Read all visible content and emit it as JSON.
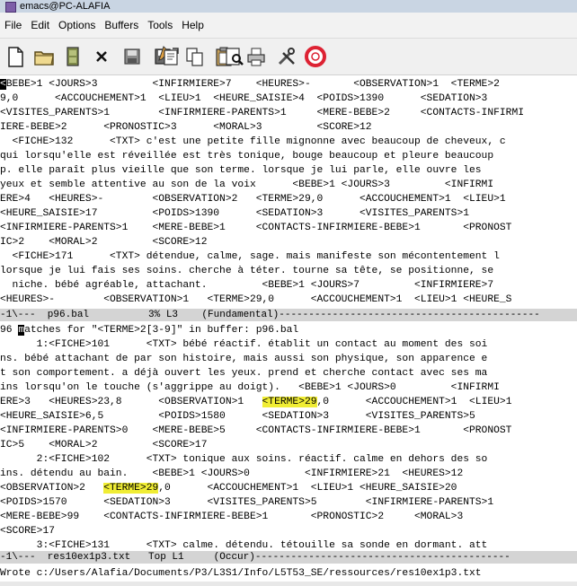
{
  "window": {
    "title": "emacs@PC-ALAFIA"
  },
  "menu": [
    "File",
    "Edit",
    "Options",
    "Buffers",
    "Tools",
    "Help"
  ],
  "toolbar": [
    {
      "name": "new-file-icon",
      "glyph": "new"
    },
    {
      "name": "open-folder-icon",
      "glyph": "folder"
    },
    {
      "name": "save-disk-icon",
      "glyph": "cabinet"
    },
    {
      "name": "close-buffer-icon",
      "glyph": "x"
    },
    {
      "name": "save-icon",
      "glyph": "disk"
    },
    {
      "name": "save-as-icon",
      "glyph": "disk2"
    },
    {
      "name": "undo-icon",
      "glyph": "undo"
    },
    {
      "name": "copy-icon",
      "glyph": "copy"
    },
    {
      "name": "paste-icon",
      "glyph": "paste"
    },
    {
      "name": "search-icon",
      "glyph": "search"
    },
    {
      "name": "print-icon",
      "glyph": "print"
    },
    {
      "name": "preferences-icon",
      "glyph": "tools"
    },
    {
      "name": "help-icon",
      "glyph": "help"
    }
  ],
  "pane1": {
    "lines": [
      "<BEBE>1 <JOURS>3         <INFIRMIERE>7    <HEURES>-       <OBSERVATION>1  <TERME>2",
      "9,0      <ACCOUCHEMENT>1  <LIEU>1  <HEURE_SAISIE>4  <POIDS>1390      <SEDATION>3",
      "<VISITES_PARENTS>1        <INFIRMIERE-PARENTS>1     <MERE-BEBE>2     <CONTACTS-INFIRMI",
      "IERE-BEBE>2      <PRONOSTIC>3      <MORAL>3         <SCORE>12",
      "  <FICHE>132      <TXT> c'est une petite fille mignonne avec beaucoup de cheveux, c",
      "qui lorsqu'elle est réveillée est très tonique, bouge beaucoup et pleure beaucoup",
      "p. elle paraît plus vieille que son terme. lorsque je lui parle, elle ouvre les",
      "yeux et semble attentive au son de la voix      <BEBE>1 <JOURS>3         <INFIRMI",
      "ERE>4   <HEURES>-        <OBSERVATION>2   <TERME>29,0      <ACCOUCHEMENT>1  <LIEU>1",
      "<HEURE_SAISIE>17         <POIDS>1390      <SEDATION>3      <VISITES_PARENTS>1",
      "<INFIRMIERE-PARENTS>1    <MERE-BEBE>1     <CONTACTS-INFIRMIERE-BEBE>1       <PRONOST",
      "IC>2    <MORAL>2         <SCORE>12",
      "  <FICHE>171      <TXT> détendue, calme, sage. mais manifeste son mécontentement l",
      "lorsque je lui fais ses soins. cherche à téter. tourne sa tête, se positionne, se",
      "  niche. bébé agréable, attachant.         <BEBE>1 <JOURS>7         <INFIRMIERE>7",
      "<HEURES>-        <OBSERVATION>1   <TERME>29,0      <ACCOUCHEMENT>1  <LIEU>1 <HEURE_S"
    ]
  },
  "modeline1": "-1\\---  p96.bal          3% L3    (Fundamental)--------------------------------------------",
  "pane2": {
    "match_header_prefix": "96 ",
    "match_header_cursor": "m",
    "match_header_rest": "atches for \"<TERME>2[3-9]\" in buffer: p96.bal",
    "highlight_text": "<TERME>29",
    "lines": [
      "      1:<FICHE>101      <TXT> bébé réactif. établit un contact au moment des soi",
      "ns. bébé attachant de par son histoire, mais aussi son physique, son apparence e",
      "t son comportement. a déjà ouvert les yeux. prend et cherche contact avec ses ma",
      "ins lorsqu'on le touche (s'aggrippe au doigt).   <BEBE>1 <JOURS>0         <INFIRMI",
      "ERE>3   <HEURES>23,8      <OBSERVATION>1   @@,0      <ACCOUCHEMENT>1  <LIEU>1",
      "<HEURE_SAISIE>6,5         <POIDS>1580      <SEDATION>3      <VISITES_PARENTS>5",
      "<INFIRMIERE-PARENTS>0    <MERE-BEBE>5     <CONTACTS-INFIRMIERE-BEBE>1       <PRONOST",
      "IC>5    <MORAL>2         <SCORE>17",
      "      2:<FICHE>102      <TXT> tonique aux soins. réactif. calme en dehors des so",
      "ins. détendu au bain.    <BEBE>1 <JOURS>0         <INFIRMIERE>21  <HEURES>12",
      "<OBSERVATION>2   @@,0      <ACCOUCHEMENT>1  <LIEU>1 <HEURE_SAISIE>20",
      "<POIDS>1570      <SEDATION>3      <VISITES_PARENTS>5        <INFIRMIERE-PARENTS>1",
      "<MERE-BEBE>99    <CONTACTS-INFIRMIERE-BEBE>1       <PRONOSTIC>2     <MORAL>3",
      "<SCORE>17",
      "      3:<FICHE>131      <TXT> calme. détendu. tétouille sa sonde en dormant. att"
    ]
  },
  "modeline2": "-1\\---  res10ex1p3.txt   Top L1     (Occur)-------------------------------------------",
  "minibuffer": "Wrote c:/Users/Alafia/Documents/P3/L3S1/Info/L5T53_SE/ressources/res10ex1p3.txt"
}
